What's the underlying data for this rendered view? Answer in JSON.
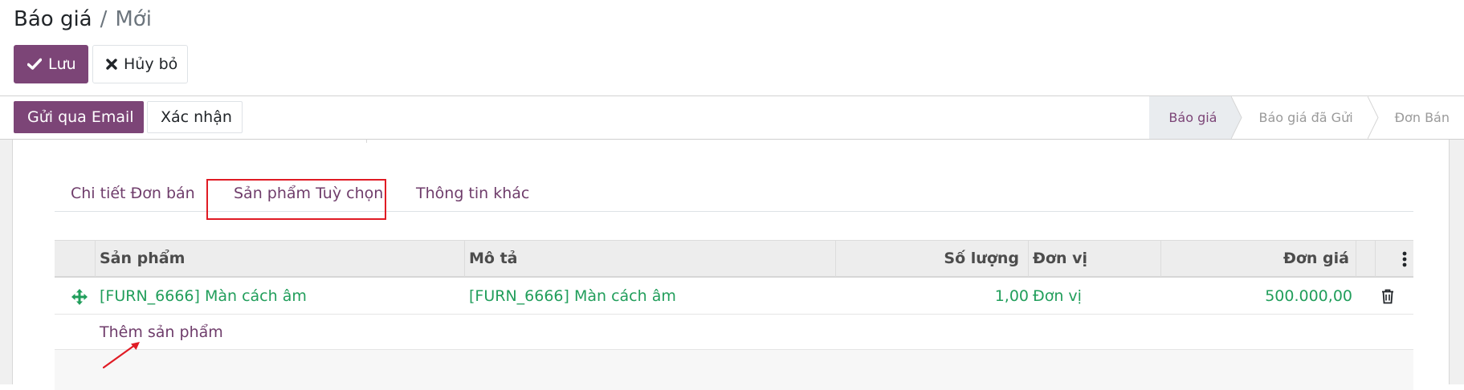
{
  "breadcrumb": {
    "root": "Báo giá",
    "separator": "/",
    "current": "Mới"
  },
  "control_panel": {
    "save_label": "Lưu",
    "discard_label": "Hủy bỏ"
  },
  "statusbar": {
    "send_email_label": "Gửi qua Email",
    "confirm_label": "Xác nhận",
    "stages": [
      {
        "label": "Báo giá",
        "active": true
      },
      {
        "label": "Báo giá đã Gửi",
        "active": false
      },
      {
        "label": "Đơn Bán",
        "active": false
      }
    ]
  },
  "tabs": [
    {
      "label": "Chi tiết Đơn bán"
    },
    {
      "label": "Sản phẩm Tuỳ chọn",
      "highlighted": true
    },
    {
      "label": "Thông tin khác"
    }
  ],
  "table": {
    "columns": [
      "Sản phẩm",
      "Mô tả",
      "Số lượng",
      "Đơn vị",
      "Đơn giá"
    ],
    "rows": [
      {
        "product": "[FURN_6666] Màn cách âm",
        "description": "[FURN_6666] Màn cách âm",
        "quantity": "1,00",
        "uom": "Đơn vị",
        "unit_price": "500.000,00"
      }
    ],
    "add_line_label": "Thêm sản phẩm"
  },
  "colors": {
    "brand": "#7c4577",
    "link": "#6f3d6b",
    "row_text": "#219e5b",
    "highlight": "#e01b24"
  },
  "icons": {
    "save": "check-icon",
    "discard": "x-icon",
    "drag": "move-icon",
    "delete": "trash-icon",
    "optional_columns": "vertical-dots-icon",
    "annotation": "arrow-icon"
  }
}
